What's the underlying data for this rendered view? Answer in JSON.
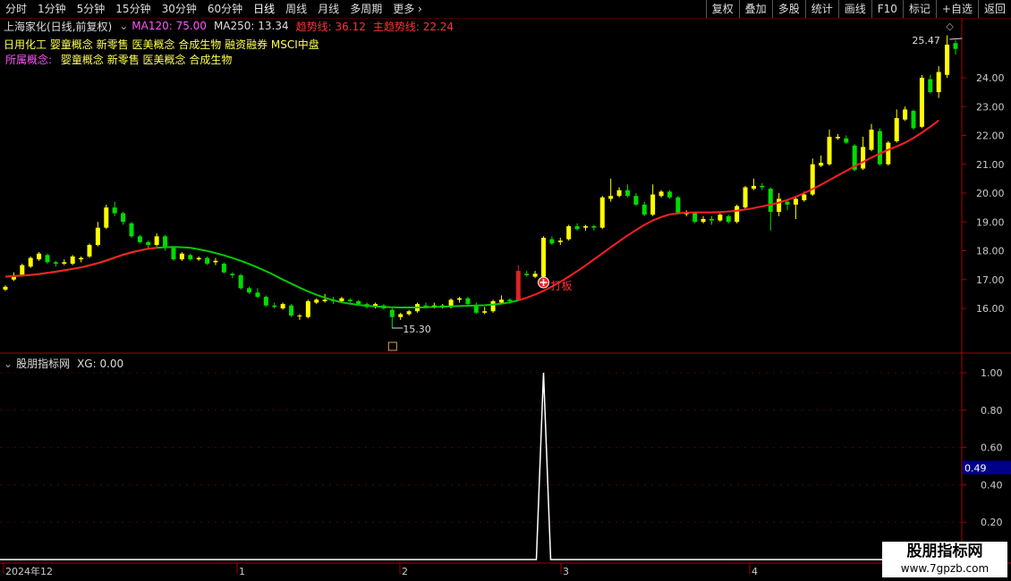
{
  "toolbar": {
    "periods": [
      "分时",
      "1分钟",
      "5分钟",
      "15分钟",
      "30分钟",
      "60分钟",
      "日线",
      "周线",
      "月线",
      "多周期",
      "更多"
    ],
    "active_period": "日线",
    "buttons": [
      "复权",
      "叠加",
      "多股",
      "统计",
      "画线",
      "F10",
      "标记",
      "+自选",
      "返回"
    ]
  },
  "info": {
    "stock": "上海家化(日线,前复权)",
    "ma120": "MA120: 75.00",
    "ma250": "MA250: 13.34",
    "trend": "趋势线: 36.12",
    "main_trend": "主趋势线: 22.24"
  },
  "board_text": "日用化工 婴童概念 新零售 医美概念 合成生物 融资融券 MSCI中盘",
  "concept": {
    "label": "所属概念:",
    "value": "婴童概念 新零售 医美概念 合成生物"
  },
  "main_chart": {
    "high_label": "25.47",
    "low_label": "15.30",
    "signal_label": "打板",
    "y_ticks": [
      "24.00",
      "23.00",
      "22.00",
      "21.00",
      "20.00",
      "19.00",
      "18.00",
      "17.00",
      "16.00"
    ]
  },
  "sub_chart": {
    "title": "股朋指标网",
    "xg": "XG: 0.00",
    "y_ticks": [
      "1.00",
      "0.80",
      "0.60",
      "0.40",
      "0.20"
    ],
    "current_value": "0.49"
  },
  "x_axis": {
    "labels": [
      "2024年12",
      "1",
      "2",
      "3",
      "4"
    ]
  },
  "watermark": {
    "line1": "股朋指标网",
    "line2": "www.7gpzb.com"
  },
  "colors": {
    "up": "#ffff00",
    "down": "#00dd00",
    "ma_up": "#ff2020",
    "ma_down": "#00cc00",
    "axis": "#aa0000"
  },
  "chart_data": {
    "type": "candlestick",
    "y_range": [
      15.3,
      25.47
    ],
    "candles": [
      [
        16.65,
        16.75,
        16.6,
        16.8
      ],
      [
        17.0,
        17.15,
        16.95,
        17.25
      ],
      [
        17.15,
        17.5,
        17.1,
        17.55
      ],
      [
        17.45,
        17.75,
        17.4,
        17.8
      ],
      [
        17.7,
        17.9,
        17.65,
        17.95
      ],
      [
        17.85,
        17.6,
        17.55,
        17.9
      ],
      [
        17.6,
        17.55,
        17.45,
        17.65
      ],
      [
        17.55,
        17.6,
        17.5,
        17.7
      ],
      [
        17.55,
        17.8,
        17.5,
        17.85
      ],
      [
        17.7,
        17.75,
        17.6,
        17.8
      ],
      [
        17.8,
        18.2,
        17.75,
        18.25
      ],
      [
        18.2,
        18.8,
        18.15,
        19.0
      ],
      [
        18.8,
        19.5,
        18.75,
        19.6
      ],
      [
        19.5,
        19.3,
        19.2,
        19.7
      ],
      [
        19.3,
        19.0,
        18.9,
        19.35
      ],
      [
        18.95,
        18.5,
        18.45,
        19.0
      ],
      [
        18.5,
        18.3,
        18.25,
        18.55
      ],
      [
        18.3,
        18.2,
        18.1,
        18.35
      ],
      [
        18.2,
        18.5,
        18.15,
        18.6
      ],
      [
        18.5,
        18.1,
        18.0,
        18.55
      ],
      [
        18.1,
        17.7,
        17.65,
        18.15
      ],
      [
        17.7,
        17.9,
        17.65,
        17.95
      ],
      [
        17.85,
        17.7,
        17.65,
        17.9
      ],
      [
        17.7,
        17.75,
        17.65,
        17.8
      ],
      [
        17.75,
        17.55,
        17.5,
        17.8
      ],
      [
        17.6,
        17.65,
        17.5,
        17.75
      ],
      [
        17.55,
        17.25,
        17.2,
        17.6
      ],
      [
        17.2,
        17.15,
        17.05,
        17.25
      ],
      [
        17.15,
        16.7,
        16.65,
        17.2
      ],
      [
        16.7,
        16.55,
        16.5,
        16.75
      ],
      [
        16.55,
        16.4,
        16.35,
        16.7
      ],
      [
        16.4,
        16.1,
        16.05,
        16.45
      ],
      [
        16.1,
        16.05,
        16.0,
        16.2
      ],
      [
        16.0,
        16.15,
        15.95,
        16.2
      ],
      [
        16.1,
        15.75,
        15.7,
        16.15
      ],
      [
        15.75,
        15.75,
        15.6,
        15.8
      ],
      [
        15.7,
        16.25,
        15.65,
        16.3
      ],
      [
        16.2,
        16.3,
        16.15,
        16.35
      ],
      [
        16.25,
        16.3,
        16.2,
        16.5
      ],
      [
        16.3,
        16.25,
        16.15,
        16.4
      ],
      [
        16.25,
        16.35,
        16.2,
        16.4
      ],
      [
        16.3,
        16.25,
        16.2,
        16.35
      ],
      [
        16.25,
        16.15,
        16.1,
        16.3
      ],
      [
        16.15,
        16.05,
        16.0,
        16.2
      ],
      [
        16.05,
        16.15,
        16.0,
        16.2
      ],
      [
        16.1,
        16.0,
        15.95,
        16.15
      ],
      [
        15.95,
        15.7,
        15.3,
        16.0
      ],
      [
        15.7,
        15.8,
        15.6,
        15.85
      ],
      [
        15.8,
        15.9,
        15.75,
        15.95
      ],
      [
        15.9,
        16.15,
        15.85,
        16.2
      ],
      [
        16.1,
        16.05,
        16.0,
        16.2
      ],
      [
        16.05,
        16.1,
        16.0,
        16.2
      ],
      [
        16.1,
        16.1,
        16.0,
        16.15
      ],
      [
        16.05,
        16.3,
        16.0,
        16.35
      ],
      [
        16.3,
        16.35,
        16.2,
        16.4
      ],
      [
        16.35,
        16.15,
        16.1,
        16.4
      ],
      [
        16.1,
        15.85,
        15.8,
        16.2
      ],
      [
        15.85,
        15.9,
        15.8,
        16.05
      ],
      [
        15.9,
        16.25,
        15.85,
        16.3
      ],
      [
        16.2,
        16.3,
        16.15,
        16.45
      ],
      [
        16.3,
        16.25,
        16.15,
        16.35
      ],
      [
        16.3,
        17.3,
        16.25,
        17.5
      ],
      [
        17.2,
        17.15,
        17.1,
        17.3
      ],
      [
        17.1,
        17.2,
        17.05,
        17.3
      ],
      [
        17.1,
        18.45,
        17.05,
        18.5
      ],
      [
        18.4,
        18.25,
        18.2,
        18.5
      ],
      [
        18.3,
        18.35,
        18.2,
        18.45
      ],
      [
        18.4,
        18.85,
        18.35,
        18.9
      ],
      [
        18.85,
        18.75,
        18.7,
        18.95
      ],
      [
        18.8,
        18.85,
        18.7,
        18.9
      ],
      [
        18.85,
        18.8,
        18.7,
        18.9
      ],
      [
        18.8,
        19.85,
        18.75,
        19.9
      ],
      [
        19.8,
        19.9,
        19.7,
        20.5
      ],
      [
        19.9,
        20.1,
        19.85,
        20.2
      ],
      [
        20.1,
        19.9,
        19.85,
        20.3
      ],
      [
        19.9,
        19.6,
        19.55,
        20.0
      ],
      [
        19.6,
        19.25,
        19.2,
        19.7
      ],
      [
        19.25,
        19.95,
        19.2,
        20.3
      ],
      [
        19.9,
        20.05,
        19.85,
        20.1
      ],
      [
        20.05,
        19.85,
        19.8,
        20.1
      ],
      [
        19.85,
        19.3,
        19.25,
        19.9
      ],
      [
        19.3,
        19.3,
        19.2,
        19.4
      ],
      [
        19.3,
        19.0,
        18.95,
        19.35
      ],
      [
        19.0,
        19.1,
        18.95,
        19.2
      ],
      [
        19.1,
        19.05,
        18.9,
        19.2
      ],
      [
        19.05,
        19.25,
        19.0,
        19.3
      ],
      [
        19.2,
        19.0,
        18.95,
        19.25
      ],
      [
        19.0,
        19.55,
        18.95,
        19.6
      ],
      [
        19.5,
        20.2,
        19.45,
        20.25
      ],
      [
        20.15,
        20.25,
        20.1,
        20.5
      ],
      [
        20.25,
        20.2,
        20.1,
        20.35
      ],
      [
        20.15,
        19.35,
        18.7,
        20.2
      ],
      [
        19.35,
        19.8,
        19.2,
        20.0
      ],
      [
        19.7,
        19.6,
        19.4,
        19.8
      ],
      [
        19.6,
        19.8,
        19.1,
        19.9
      ],
      [
        19.75,
        19.95,
        19.7,
        20.05
      ],
      [
        19.95,
        21.0,
        19.9,
        21.2
      ],
      [
        20.95,
        21.05,
        20.9,
        21.3
      ],
      [
        21.0,
        21.95,
        20.95,
        22.2
      ],
      [
        21.9,
        21.95,
        21.85,
        22.05
      ],
      [
        21.9,
        21.75,
        21.7,
        22.0
      ],
      [
        21.65,
        20.8,
        20.75,
        21.7
      ],
      [
        20.85,
        21.6,
        20.8,
        21.95
      ],
      [
        21.5,
        22.2,
        21.45,
        22.4
      ],
      [
        22.15,
        21.0,
        20.95,
        22.25
      ],
      [
        21.0,
        21.75,
        20.95,
        21.8
      ],
      [
        21.8,
        22.6,
        21.75,
        22.9
      ],
      [
        22.55,
        22.9,
        22.5,
        23.0
      ],
      [
        22.85,
        22.25,
        22.2,
        22.9
      ],
      [
        22.3,
        24.0,
        22.25,
        24.1
      ],
      [
        23.95,
        23.5,
        23.45,
        24.1
      ],
      [
        23.5,
        24.2,
        23.3,
        24.4
      ],
      [
        24.1,
        25.15,
        24.0,
        25.47
      ],
      [
        25.2,
        25.0,
        24.8,
        25.3
      ]
    ],
    "ma_line": [
      17.1,
      17.12,
      17.14,
      17.16,
      17.19,
      17.23,
      17.27,
      17.32,
      17.37,
      17.42,
      17.49,
      17.57,
      17.66,
      17.76,
      17.86,
      17.94,
      18.01,
      18.07,
      18.1,
      18.12,
      18.13,
      18.12,
      18.1,
      18.05,
      17.99,
      17.92,
      17.84,
      17.75,
      17.65,
      17.54,
      17.42,
      17.29,
      17.15,
      17.0,
      16.86,
      16.72,
      16.59,
      16.47,
      16.37,
      16.28,
      16.21,
      16.16,
      16.12,
      16.09,
      16.07,
      16.05,
      16.04,
      16.03,
      16.03,
      16.03,
      16.04,
      16.05,
      16.06,
      16.07,
      16.08,
      16.09,
      16.1,
      16.11,
      16.13,
      16.16,
      16.21,
      16.28,
      16.37,
      16.48,
      16.61,
      16.76,
      16.92,
      17.1,
      17.29,
      17.49,
      17.7,
      17.91,
      18.12,
      18.33,
      18.53,
      18.72,
      18.9,
      19.05,
      19.17,
      19.26,
      19.3,
      19.32,
      19.33,
      19.33,
      19.33,
      19.34,
      19.36,
      19.39,
      19.43,
      19.48,
      19.54,
      19.6,
      19.67,
      19.76,
      19.87,
      20.0,
      20.14,
      20.29,
      20.45,
      20.61,
      20.77,
      20.93,
      21.08,
      21.23,
      21.37,
      21.5,
      21.62,
      21.75,
      21.91,
      22.1,
      22.3,
      22.52
    ],
    "ma_color_split": 61,
    "signal_index": 64,
    "sub_series": {
      "spike_index": 64,
      "spike_value": 1.0,
      "y_range": [
        0,
        1
      ]
    }
  }
}
